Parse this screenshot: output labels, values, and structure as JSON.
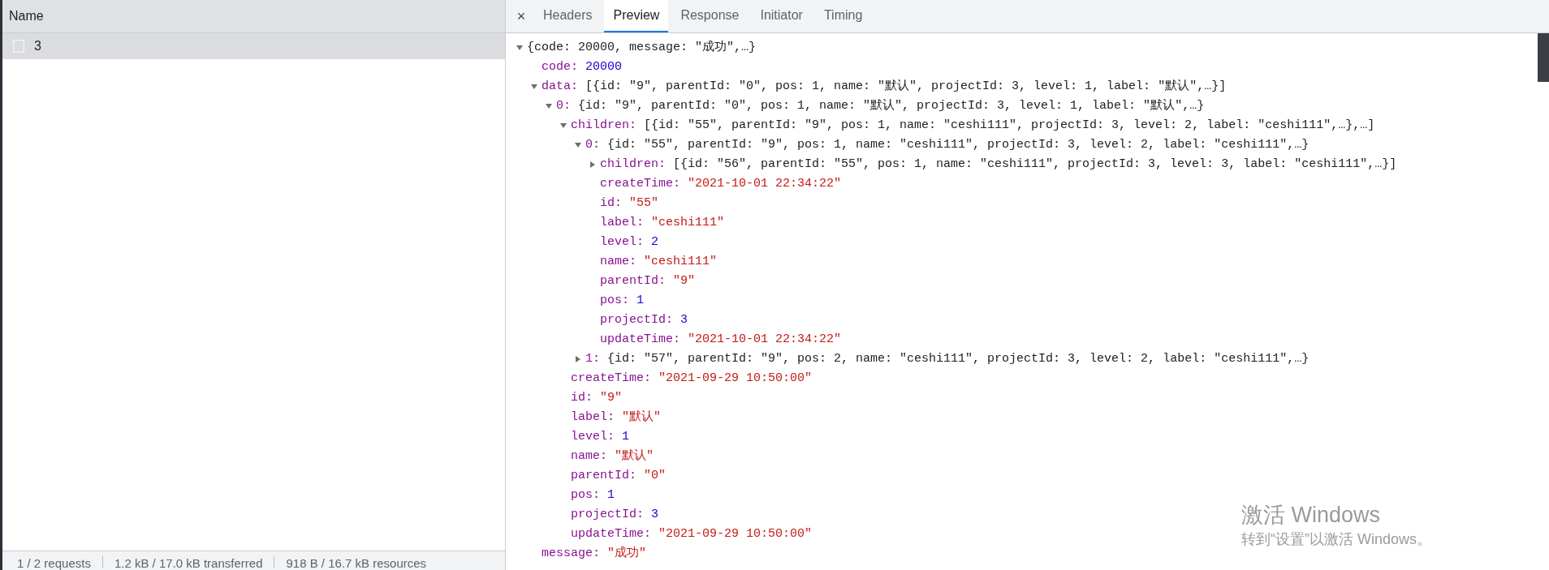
{
  "requests_panel": {
    "column_header": "Name",
    "rows": [
      {
        "name": "3",
        "selected": true
      }
    ],
    "status_bar": [
      "1 / 2 requests",
      "1.2 kB / 17.0 kB transferred",
      "918 B / 16.7 kB resources"
    ]
  },
  "detail_tabs": [
    {
      "label": "Headers",
      "selected": false
    },
    {
      "label": "Preview",
      "selected": true
    },
    {
      "label": "Response",
      "selected": false
    },
    {
      "label": "Initiator",
      "selected": false
    },
    {
      "label": "Timing",
      "selected": false
    }
  ],
  "close_glyph": "×",
  "preview_tree": {
    "kind": "object",
    "summary": "{code: 20000, message: \"成功\",…}",
    "expanded": true,
    "children": [
      {
        "kind": "number",
        "key": "code:",
        "value": "20000"
      },
      {
        "kind": "object",
        "key": "data:",
        "summary": "[{id: \"9\", parentId: \"0\", pos: 1, name: \"默认\", projectId: 3, level: 1, label: \"默认\",…}]",
        "expanded": true,
        "children": [
          {
            "kind": "object",
            "key": "0:",
            "summary": "{id: \"9\", parentId: \"0\", pos: 1, name: \"默认\", projectId: 3, level: 1, label: \"默认\",…}",
            "expanded": true,
            "children": [
              {
                "kind": "object",
                "key": "children:",
                "summary": "[{id: \"55\", parentId: \"9\", pos: 1, name: \"ceshi111\", projectId: 3, level: 2, label: \"ceshi111\",…},…]",
                "expanded": true,
                "children": [
                  {
                    "kind": "object",
                    "key": "0:",
                    "summary": "{id: \"55\", parentId: \"9\", pos: 1, name: \"ceshi111\", projectId: 3, level: 2, label: \"ceshi111\",…}",
                    "expanded": true,
                    "children": [
                      {
                        "kind": "object",
                        "key": "children:",
                        "summary": "[{id: \"56\", parentId: \"55\", pos: 1, name: \"ceshi111\", projectId: 3, level: 3, label: \"ceshi111\",…}]",
                        "expanded": false
                      },
                      {
                        "kind": "string",
                        "key": "createTime:",
                        "value": "\"2021-10-01 22:34:22\""
                      },
                      {
                        "kind": "string",
                        "key": "id:",
                        "value": "\"55\""
                      },
                      {
                        "kind": "string",
                        "key": "label:",
                        "value": "\"ceshi111\""
                      },
                      {
                        "kind": "number",
                        "key": "level:",
                        "value": "2"
                      },
                      {
                        "kind": "string",
                        "key": "name:",
                        "value": "\"ceshi111\""
                      },
                      {
                        "kind": "string",
                        "key": "parentId:",
                        "value": "\"9\""
                      },
                      {
                        "kind": "number",
                        "key": "pos:",
                        "value": "1"
                      },
                      {
                        "kind": "number",
                        "key": "projectId:",
                        "value": "3"
                      },
                      {
                        "kind": "string",
                        "key": "updateTime:",
                        "value": "\"2021-10-01 22:34:22\""
                      }
                    ]
                  },
                  {
                    "kind": "object",
                    "key": "1:",
                    "summary": "{id: \"57\", parentId: \"9\", pos: 2, name: \"ceshi111\", projectId: 3, level: 2, label: \"ceshi111\",…}",
                    "expanded": false
                  }
                ]
              },
              {
                "kind": "string",
                "key": "createTime:",
                "value": "\"2021-09-29 10:50:00\""
              },
              {
                "kind": "string",
                "key": "id:",
                "value": "\"9\""
              },
              {
                "kind": "string",
                "key": "label:",
                "value": "\"默认\""
              },
              {
                "kind": "number",
                "key": "level:",
                "value": "1"
              },
              {
                "kind": "string",
                "key": "name:",
                "value": "\"默认\""
              },
              {
                "kind": "string",
                "key": "parentId:",
                "value": "\"0\""
              },
              {
                "kind": "number",
                "key": "pos:",
                "value": "1"
              },
              {
                "kind": "number",
                "key": "projectId:",
                "value": "3"
              },
              {
                "kind": "string",
                "key": "updateTime:",
                "value": "\"2021-09-29 10:50:00\""
              }
            ]
          }
        ]
      },
      {
        "kind": "string",
        "key": "message:",
        "value": "\"成功\""
      }
    ]
  },
  "activation_notice": {
    "title": "激活 Windows",
    "hint": "转到“设置”以激活 Windows。"
  }
}
